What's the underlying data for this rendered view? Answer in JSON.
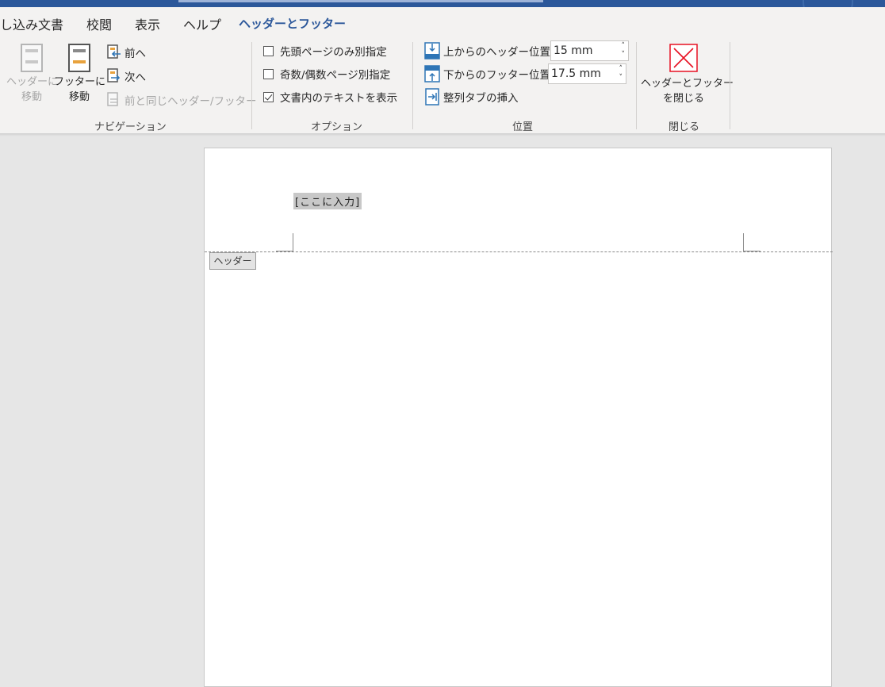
{
  "tabs": [
    {
      "label": "差し込み文書"
    },
    {
      "label": "校閲"
    },
    {
      "label": "表示"
    },
    {
      "label": "ヘルプ"
    },
    {
      "label": "ヘッダーとフッター",
      "active": true
    }
  ],
  "navigation": {
    "group_label": "ナビゲーション",
    "goto_header": {
      "line1": "ヘッダーに",
      "line2": "移動",
      "enabled": false
    },
    "goto_footer": {
      "line1": "フッターに",
      "line2": "移動",
      "enabled": true
    },
    "previous": "前へ",
    "next": "次へ",
    "link_previous": {
      "label": "前と同じヘッダー/フッター",
      "enabled": false
    }
  },
  "options": {
    "group_label": "オプション",
    "items": [
      {
        "label": "先頭ページのみ別指定",
        "checked": false
      },
      {
        "label": "奇数/偶数ページ別指定",
        "checked": false
      },
      {
        "label": "文書内のテキストを表示",
        "checked": true
      }
    ]
  },
  "position": {
    "group_label": "位置",
    "header_from_top": {
      "label": "上からのヘッダー位置:",
      "value": "15 mm"
    },
    "footer_from_bottom": {
      "label": "下からのフッター位置:",
      "value": "17.5 mm"
    },
    "insert_alignment_tab": "整列タブの挿入"
  },
  "close": {
    "group_label": "閉じる",
    "button_line1": "ヘッダーとフッター",
    "button_line2": "を閉じる"
  },
  "document": {
    "header_placeholder": "[ここに入力]",
    "header_tag": "ヘッダー"
  },
  "colors": {
    "accent": "#2b579a",
    "close_red": "#e81123",
    "icon_orange": "#e8a23d",
    "icon_blue": "#2e75b6"
  }
}
